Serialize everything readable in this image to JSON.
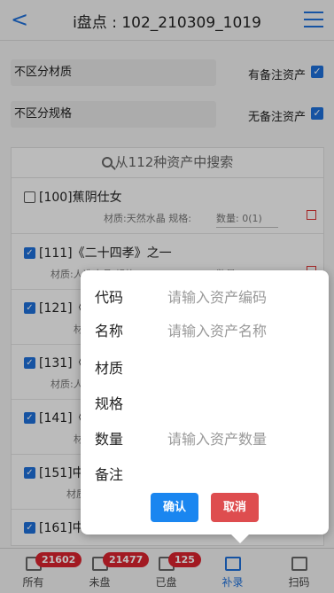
{
  "header": {
    "back": "<",
    "title": "i盘点 : 102_210309_1019"
  },
  "filters": [
    {
      "select": "不区分材质",
      "checkbox_label": "有备注资产",
      "checked": true
    },
    {
      "select": "不区分规格",
      "checkbox_label": "无备注资产",
      "checked": true
    }
  ],
  "search": {
    "text": "从112种资产中搜索"
  },
  "items": [
    {
      "name": "[100]蕉阴仕女",
      "meta": "材质:天然水晶 规格:",
      "qty": "数量: 0(1)",
      "checked": false
    },
    {
      "name": "[111]《二十四孝》之一",
      "meta": "材质:人造水晶 规格:015-313-0",
      "qty": "数量: 0(1)",
      "checked": true
    },
    {
      "name": "[121]《",
      "meta": "材",
      "qty": "",
      "checked": true
    },
    {
      "name": "[131]《",
      "meta": "材质:人",
      "qty": "",
      "checked": true
    },
    {
      "name": "[141]《",
      "meta": "材",
      "qty": "",
      "checked": true
    },
    {
      "name": "[151]中",
      "meta": "材质",
      "qty": "",
      "checked": true
    },
    {
      "name": "[161]中国画-福禄寿",
      "meta": "",
      "qty": "",
      "checked": true
    }
  ],
  "popup": {
    "fields": [
      {
        "label": "代码",
        "placeholder": "请输入资产编码"
      },
      {
        "label": "名称",
        "placeholder": "请输入资产名称"
      },
      {
        "label": "材质",
        "placeholder": ""
      },
      {
        "label": "规格",
        "placeholder": ""
      },
      {
        "label": "数量",
        "placeholder": "请输入资产数量"
      },
      {
        "label": "备注",
        "placeholder": ""
      }
    ],
    "confirm_label": "确认",
    "cancel_label": "取消"
  },
  "tabbar": {
    "tabs": [
      {
        "label": "所有",
        "badge": "21602",
        "icon": "home-icon"
      },
      {
        "label": "未盘",
        "badge": "21477",
        "icon": "clipboard-icon"
      },
      {
        "label": "已盘",
        "badge": "125",
        "icon": "star-icon"
      },
      {
        "label": "补录",
        "badge": "",
        "icon": "edit-icon",
        "active": true
      },
      {
        "label": "扫码",
        "badge": "",
        "icon": "camera-icon"
      }
    ]
  },
  "colors": {
    "accent": "#1e6fd9",
    "badge": "#d9232e",
    "confirm": "#1a86f0",
    "cancel": "#de4d4f"
  }
}
